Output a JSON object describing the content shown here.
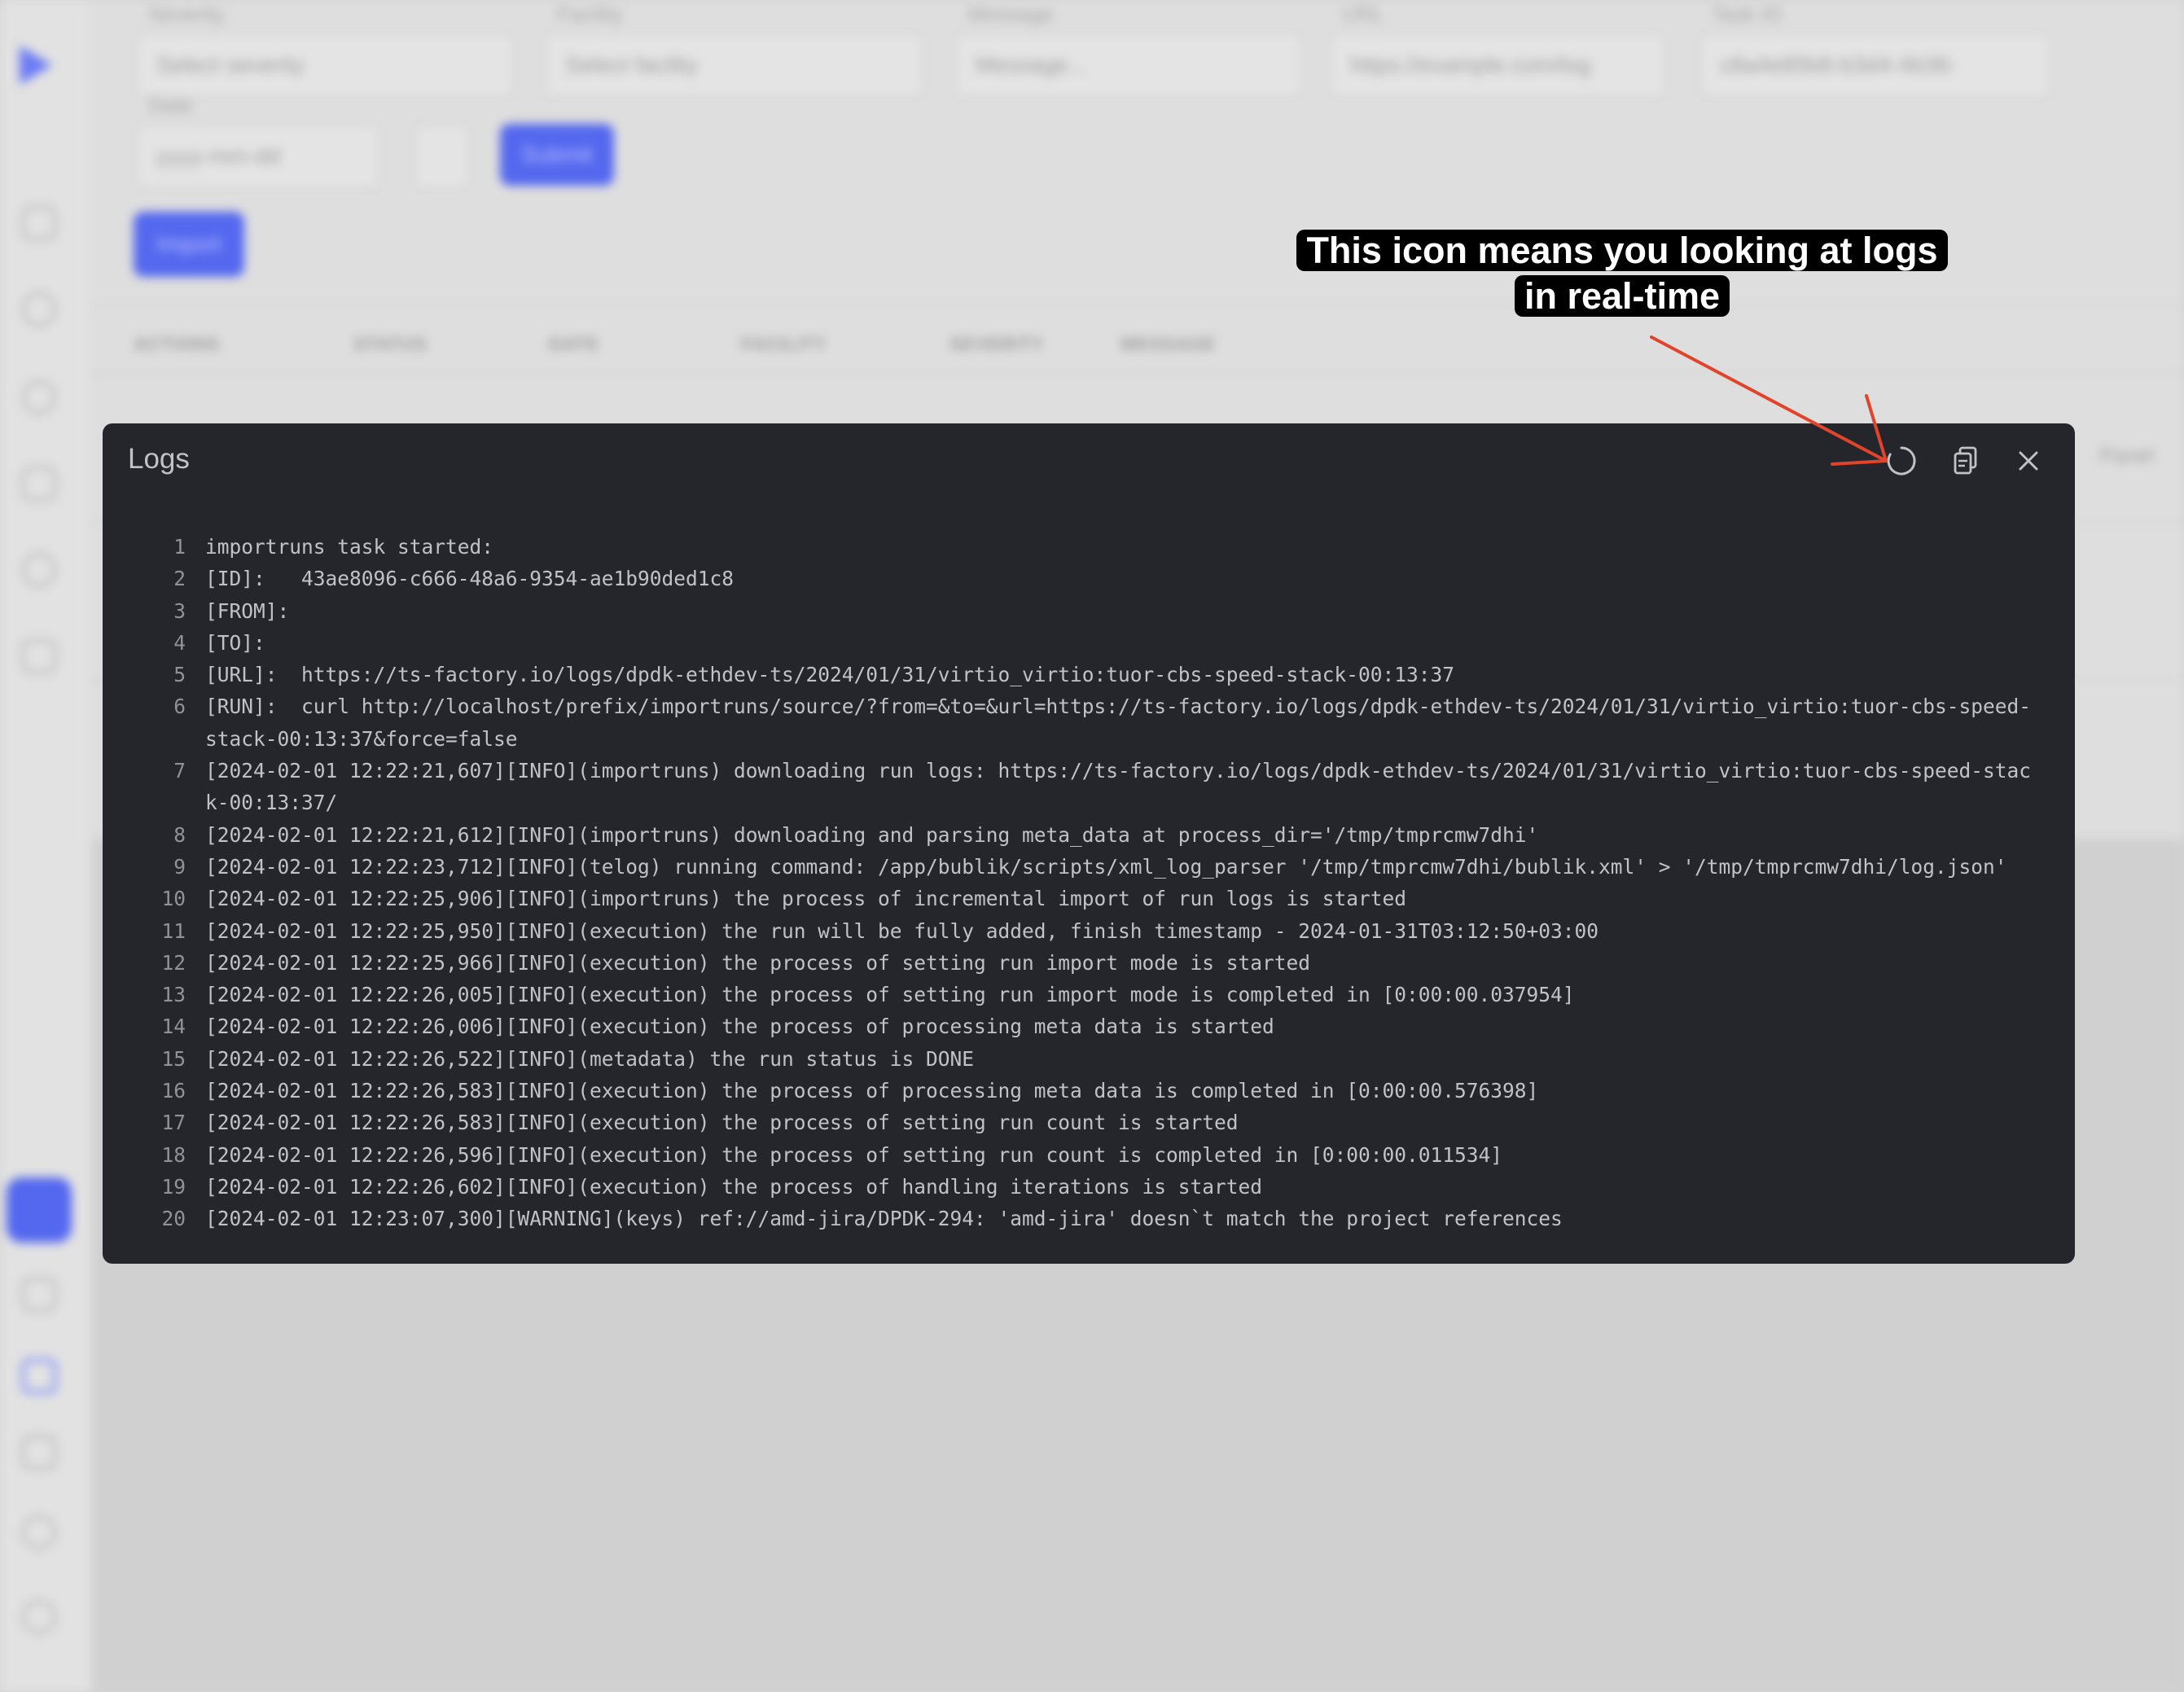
{
  "background": {
    "filters": [
      {
        "label": "Severity",
        "value": "Select severity"
      },
      {
        "label": "Facility",
        "value": "Select facility"
      },
      {
        "label": "Message",
        "value": "Message..."
      },
      {
        "label": "URL",
        "value": "https://example.com/log"
      },
      {
        "label": "Task ID",
        "value": "c8a4e85b8-b3d4-4b36-"
      }
    ],
    "date": {
      "label": "Date",
      "value": "yyyy-mm-dd"
    },
    "submit_label": "Submit",
    "import_label": "Import",
    "table_headers": [
      "ACTIONS",
      "STATUS",
      "DATE",
      "FACILITY",
      "SEVERITY",
      "MESSAGE"
    ],
    "side_text": "Panel"
  },
  "modal": {
    "title": "Logs",
    "lines": [
      {
        "n": "1",
        "text": "importruns task started:"
      },
      {
        "n": "2",
        "text": "[ID]:   43ae8096-c666-48a6-9354-ae1b90ded1c8"
      },
      {
        "n": "3",
        "text": "[FROM]:"
      },
      {
        "n": "4",
        "text": "[TO]:"
      },
      {
        "n": "5",
        "text": "[URL]:  https://ts-factory.io/logs/dpdk-ethdev-ts/2024/01/31/virtio_virtio:tuor-cbs-speed-stack-00:13:37"
      },
      {
        "n": "6",
        "text": "[RUN]:  curl http://localhost/prefix/importruns/source/?from=&to=&url=https://ts-factory.io/logs/dpdk-ethdev-ts/2024/01/31/virtio_virtio:tuor-cbs-speed-stack-00:13:37&force=false"
      },
      {
        "n": "7",
        "text": "[2024-02-01 12:22:21,607][INFO](importruns) downloading run logs: https://ts-factory.io/logs/dpdk-ethdev-ts/2024/01/31/virtio_virtio:tuor-cbs-speed-stack-00:13:37/"
      },
      {
        "n": "8",
        "text": "[2024-02-01 12:22:21,612][INFO](importruns) downloading and parsing meta_data at process_dir='/tmp/tmprcmw7dhi'"
      },
      {
        "n": "9",
        "text": "[2024-02-01 12:22:23,712][INFO](telog) running command: /app/bublik/scripts/xml_log_parser '/tmp/tmprcmw7dhi/bublik.xml' > '/tmp/tmprcmw7dhi/log.json'"
      },
      {
        "n": "10",
        "text": "[2024-02-01 12:22:25,906][INFO](importruns) the process of incremental import of run logs is started"
      },
      {
        "n": "11",
        "text": "[2024-02-01 12:22:25,950][INFO](execution) the run will be fully added, finish timestamp - 2024-01-31T03:12:50+03:00"
      },
      {
        "n": "12",
        "text": "[2024-02-01 12:22:25,966][INFO](execution) the process of setting run import mode is started"
      },
      {
        "n": "13",
        "text": "[2024-02-01 12:22:26,005][INFO](execution) the process of setting run import mode is completed in [0:00:00.037954]"
      },
      {
        "n": "14",
        "text": "[2024-02-01 12:22:26,006][INFO](execution) the process of processing meta data is started"
      },
      {
        "n": "15",
        "text": "[2024-02-01 12:22:26,522][INFO](metadata) the run status is DONE"
      },
      {
        "n": "16",
        "text": "[2024-02-01 12:22:26,583][INFO](execution) the process of processing meta data is completed in [0:00:00.576398]"
      },
      {
        "n": "17",
        "text": "[2024-02-01 12:22:26,583][INFO](execution) the process of setting run count is started"
      },
      {
        "n": "18",
        "text": "[2024-02-01 12:22:26,596][INFO](execution) the process of setting run count is completed in [0:00:00.011534]"
      },
      {
        "n": "19",
        "text": "[2024-02-01 12:22:26,602][INFO](execution) the process of handling iterations is started"
      },
      {
        "n": "20",
        "text": "[2024-02-01 12:23:07,300][WARNING](keys) ref://amd-jira/DPDK-294: 'amd-jira' doesn`t match the project references"
      }
    ],
    "icons": [
      "refresh-icon",
      "copy-icon",
      "close-icon"
    ]
  },
  "annotation": {
    "line1": "This icon means you looking at logs",
    "line2": "in real-time",
    "color": "#e0442b"
  }
}
